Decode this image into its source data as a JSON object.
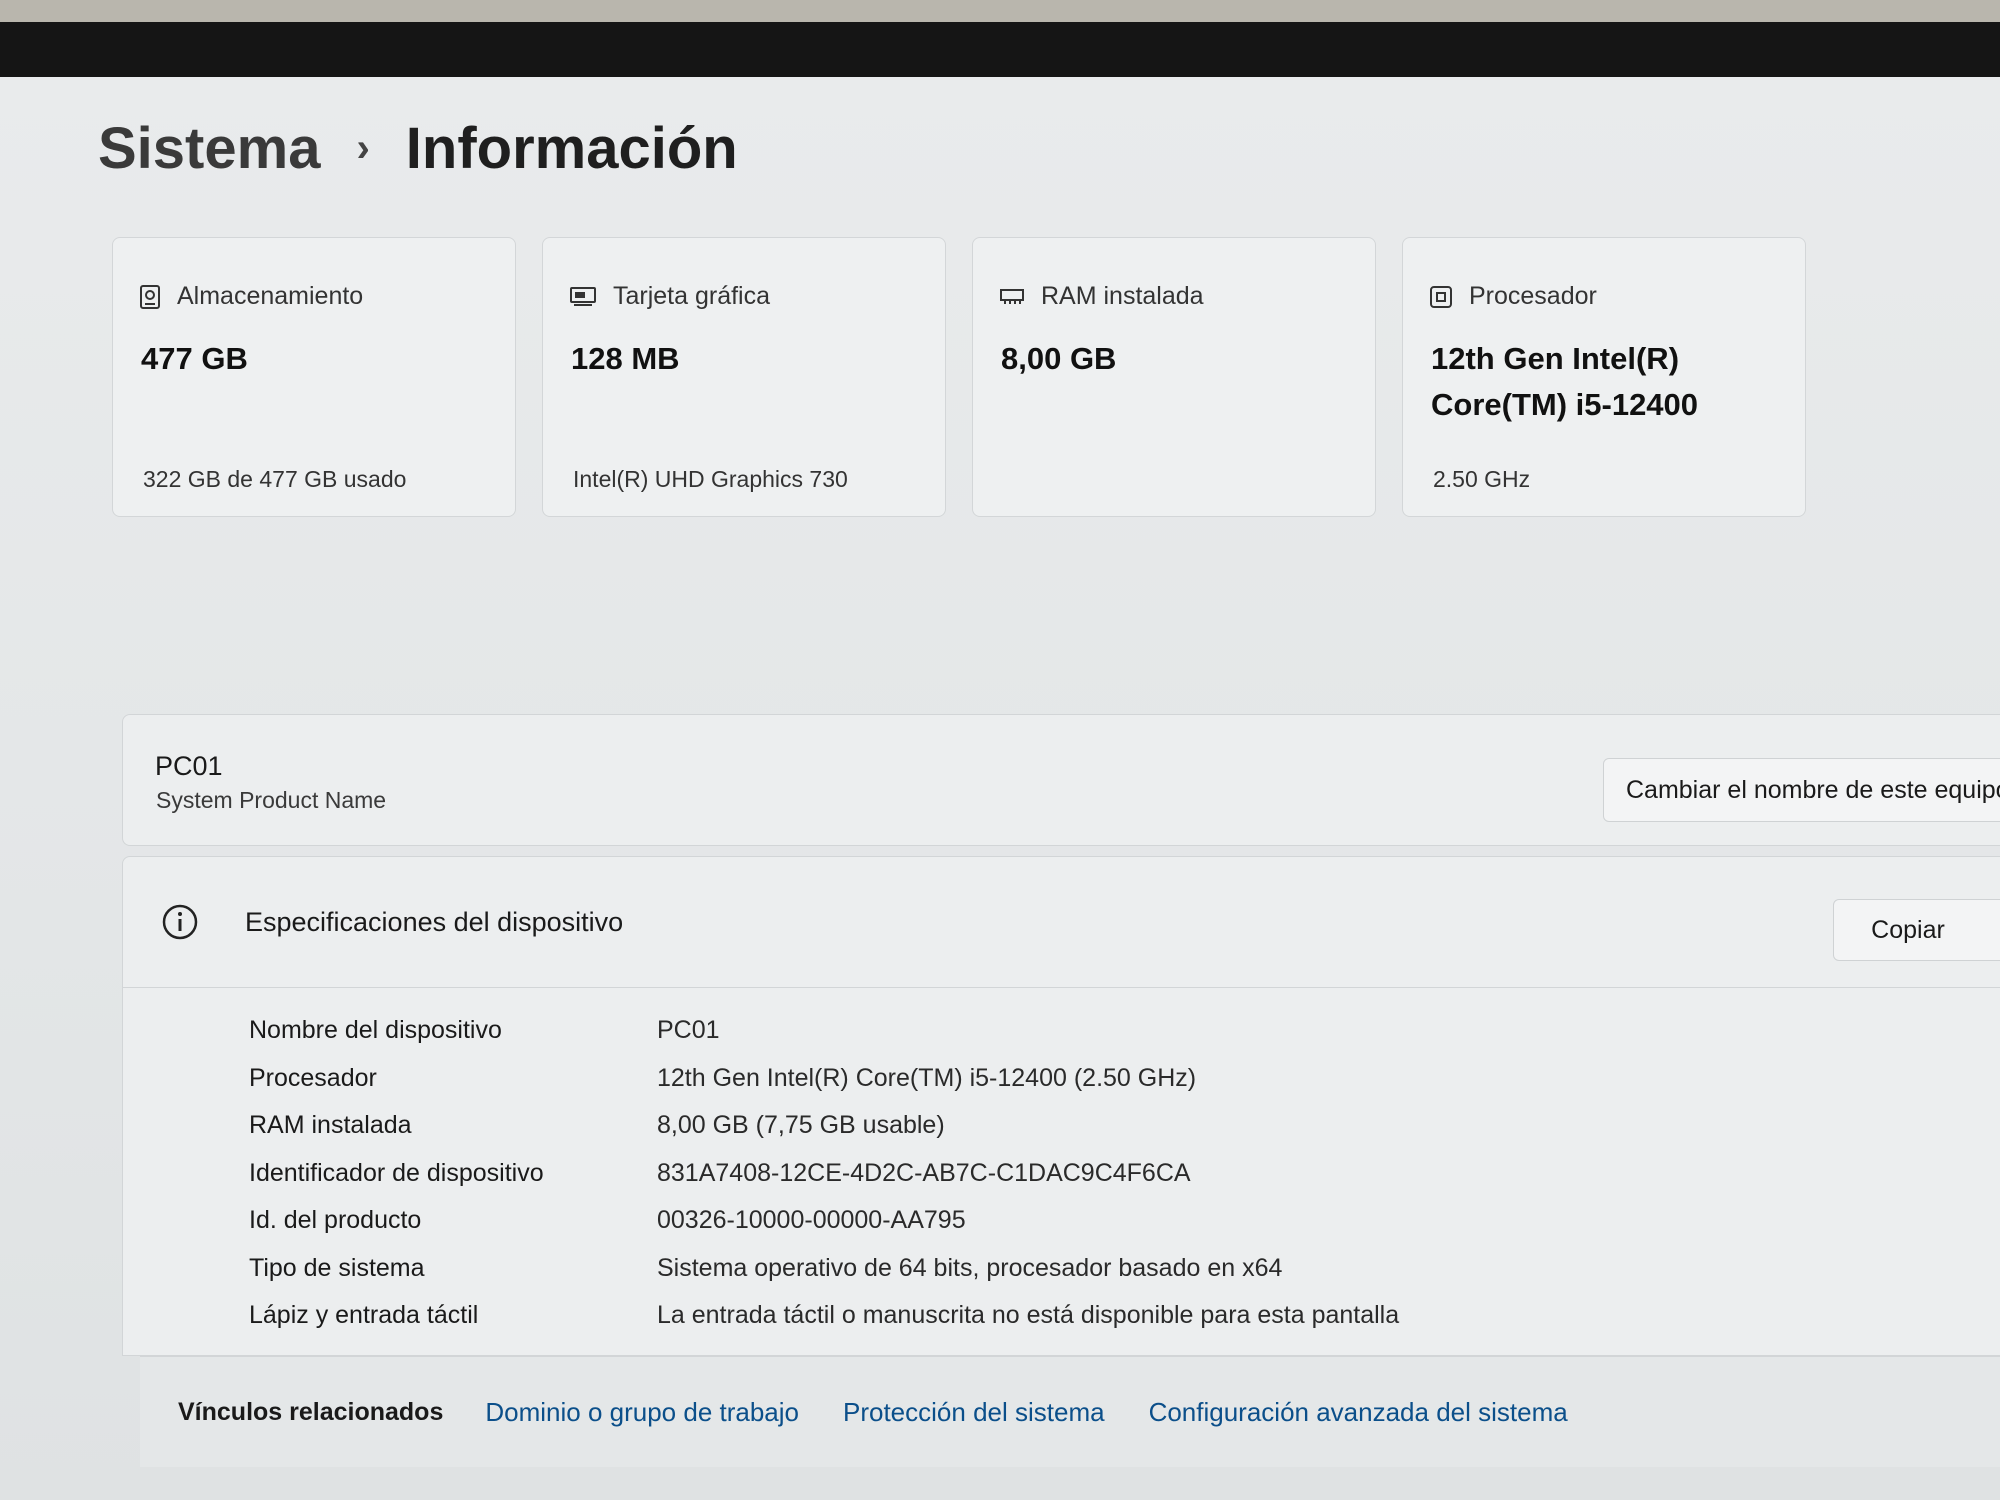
{
  "breadcrumb": {
    "parent": "Sistema",
    "separator": "›",
    "current": "Información"
  },
  "cards": [
    {
      "title": "Almacenamiento",
      "value": "477 GB",
      "sub": "322 GB de 477 GB usado",
      "icon": "storage-icon"
    },
    {
      "title": "Tarjeta gráfica",
      "value": "128 MB",
      "sub": "Intel(R) UHD Graphics 730",
      "icon": "graphics-card-icon"
    },
    {
      "title": "RAM instalada",
      "value": "8,00 GB",
      "sub": "",
      "icon": "ram-icon"
    },
    {
      "title": "Procesador",
      "value_line1": "12th Gen Intel(R)",
      "value_line2": "Core(TM) i5-12400",
      "sub": "2.50 GHz",
      "icon": "processor-icon"
    }
  ],
  "device": {
    "name": "PC01",
    "model": "System Product Name",
    "rename_button": "Cambiar el nombre de este equipo"
  },
  "specs": {
    "title": "Especificaciones del dispositivo",
    "copy_button": "Copiar",
    "rows": [
      {
        "label": "Nombre del dispositivo",
        "value": "PC01"
      },
      {
        "label": "Procesador",
        "value": "12th Gen Intel(R) Core(TM) i5-12400 (2.50 GHz)"
      },
      {
        "label": "RAM instalada",
        "value": "8,00 GB (7,75 GB usable)"
      },
      {
        "label": "Identificador de dispositivo",
        "value": "831A7408-12CE-4D2C-AB7C-C1DAC9C4F6CA"
      },
      {
        "label": "Id. del producto",
        "value": "00326-10000-00000-AA795"
      },
      {
        "label": "Tipo de sistema",
        "value": "Sistema operativo de 64 bits, procesador basado en x64"
      },
      {
        "label": "Lápiz y entrada táctil",
        "value": "La entrada táctil o manuscrita no está disponible para esta pantalla"
      }
    ]
  },
  "related": {
    "title": "Vínculos relacionados",
    "links": [
      "Dominio o grupo de trabajo",
      "Protección del sistema",
      "Configuración avanzada del sistema"
    ]
  },
  "colors": {
    "link": "#0b4f8a",
    "background": "#e6e8e9",
    "card": "#eef0f1"
  }
}
